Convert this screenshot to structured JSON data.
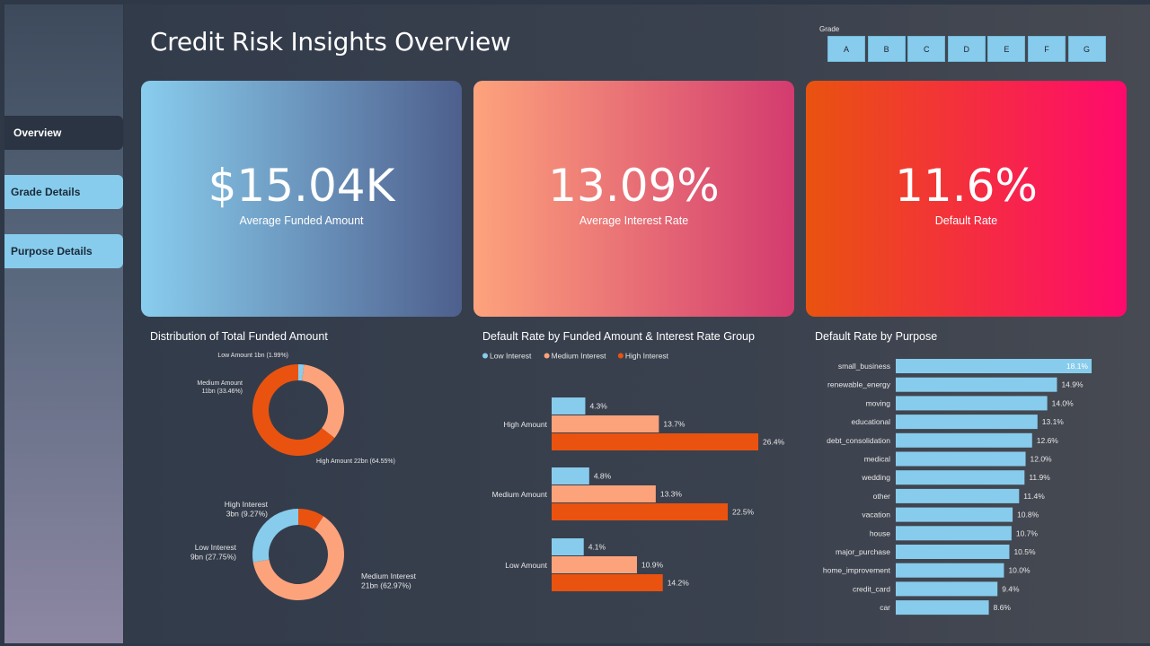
{
  "header": {
    "title": "Credit Risk Insights Overview"
  },
  "sidebar": {
    "items": [
      {
        "label": "Overview"
      },
      {
        "label": "Grade Details"
      },
      {
        "label": "Purpose Details"
      }
    ]
  },
  "grade_filter": {
    "label": "Grade",
    "options": [
      "A",
      "B",
      "C",
      "D",
      "E",
      "F",
      "G"
    ]
  },
  "kpis": [
    {
      "value": "$15.04K",
      "label": "Average Funded Amount"
    },
    {
      "value": "13.09%",
      "label": "Average Interest Rate"
    },
    {
      "value": "11.6%",
      "label": "Default Rate"
    }
  ],
  "colors": {
    "light_blue": "#87ccec",
    "salmon": "#fda37c",
    "orange": "#e9530f"
  },
  "chart_data": [
    {
      "type": "pie",
      "title": "Distribution of Total Funded Amount",
      "slices": [
        {
          "label": "Low Amount",
          "value": 1.99,
          "display": "Low Amount 1bn (1.99%)",
          "color": "#87ccec"
        },
        {
          "label": "Medium Amount",
          "value": 33.46,
          "display": "Medium Amount 11bn (33.46%)",
          "color": "#fda37c"
        },
        {
          "label": "High Amount",
          "value": 64.55,
          "display": "High Amount 22bn (64.55%)",
          "color": "#e9530f"
        }
      ]
    },
    {
      "type": "pie",
      "slices": [
        {
          "label": "High Interest",
          "value": 9.27,
          "display": "High Interest 3bn (9.27%)",
          "color": "#e9530f"
        },
        {
          "label": "Medium Interest",
          "value": 62.97,
          "display": "Medium Interest 21bn (62.97%)",
          "color": "#fda37c"
        },
        {
          "label": "Low Interest",
          "value": 27.75,
          "display": "Low Interest 9bn (27.75%)",
          "color": "#87ccec"
        }
      ]
    },
    {
      "type": "bar",
      "orientation": "horizontal",
      "title": "Default Rate by Funded Amount & Interest Rate Group",
      "legend_position": "top-left",
      "categories": [
        "High Amount",
        "Medium Amount",
        "Low Amount"
      ],
      "series": [
        {
          "name": "Low Interest",
          "color": "#87ccec",
          "values": [
            4.3,
            4.8,
            4.1
          ],
          "labels": [
            "4.3%",
            "4.8%",
            "4.1%"
          ]
        },
        {
          "name": "Medium Interest",
          "color": "#fda37c",
          "values": [
            13.7,
            13.3,
            10.9
          ],
          "labels": [
            "13.7%",
            "13.3%",
            "10.9%"
          ]
        },
        {
          "name": "High Interest",
          "color": "#e9530f",
          "values": [
            26.4,
            22.5,
            14.2
          ],
          "labels": [
            "26.4%",
            "22.5%",
            "14.2%"
          ]
        }
      ]
    },
    {
      "type": "bar",
      "orientation": "horizontal",
      "title": "Default Rate by Purpose",
      "categories": [
        "small_business",
        "renewable_energy",
        "moving",
        "educational",
        "debt_consolidation",
        "medical",
        "wedding",
        "other",
        "vacation",
        "house",
        "major_purchase",
        "home_improvement",
        "credit_card",
        "car"
      ],
      "values": [
        18.1,
        14.9,
        14.0,
        13.1,
        12.6,
        12.0,
        11.9,
        11.4,
        10.8,
        10.7,
        10.5,
        10.0,
        9.4,
        8.6
      ],
      "labels": [
        "18.1%",
        "14.9%",
        "14.0%",
        "13.1%",
        "12.6%",
        "12.0%",
        "11.9%",
        "11.4%",
        "10.8%",
        "10.7%",
        "10.5%",
        "10.0%",
        "9.4%",
        "8.6%"
      ],
      "color": "#87ccec"
    }
  ]
}
